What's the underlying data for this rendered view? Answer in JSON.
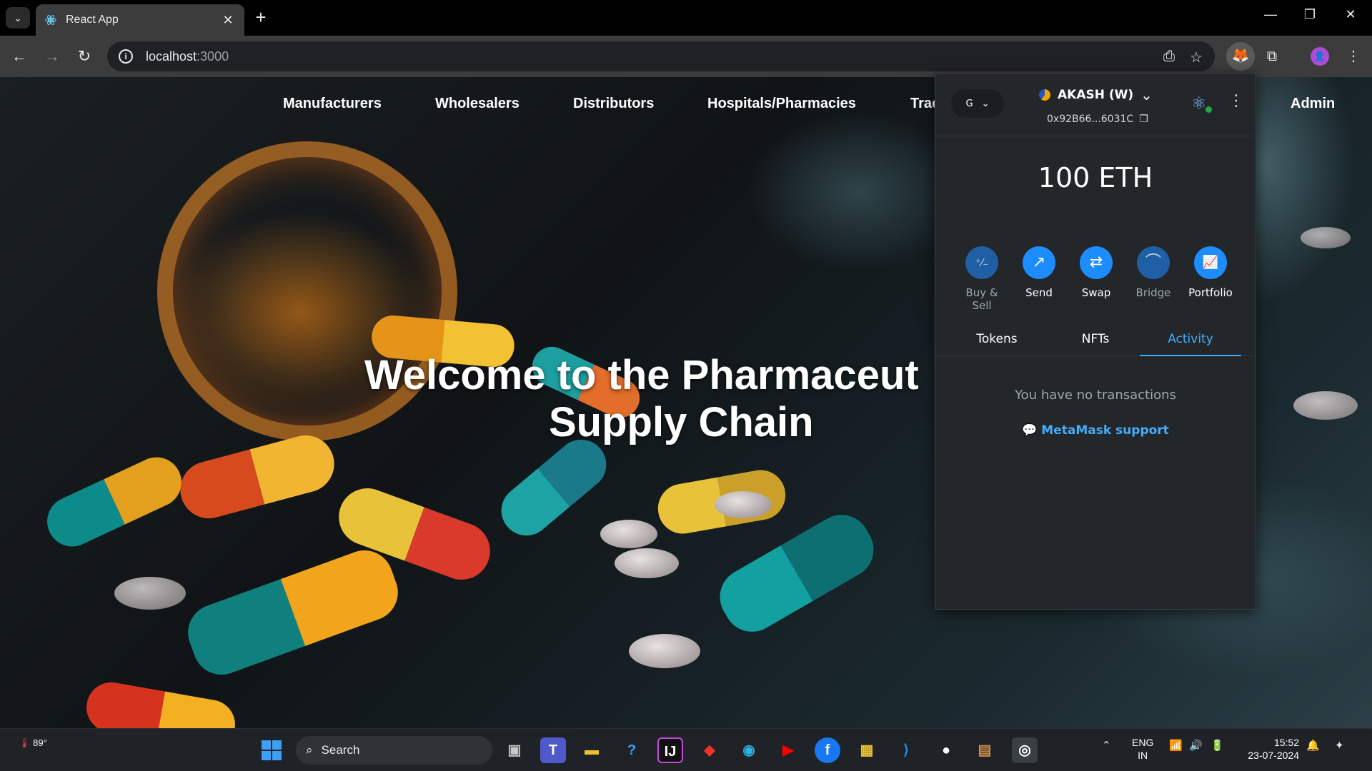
{
  "browser": {
    "tab_title": "React App",
    "tab_close": "✕",
    "new_tab": "+",
    "url_host": "localhost",
    "url_port": ":3000",
    "window_controls": [
      "—",
      "❐",
      "✕"
    ],
    "profile_initial": "👤"
  },
  "nav": {
    "items": [
      "Manufacturers",
      "Wholesalers",
      "Distributors",
      "Hospitals/Pharmacies",
      "Trac",
      "Admin"
    ]
  },
  "hero": {
    "line1": "Welcome to the Pharmaceut",
    "line2": "Supply Chain"
  },
  "metamask": {
    "network_letter": "G",
    "account_name": "AKASH (W)",
    "address": "0x92B66...6031C",
    "balance": "100 ETH",
    "actions": [
      {
        "label": "Buy & Sell",
        "icon": "buy-sell-icon",
        "glyph": "⁺⁄₋"
      },
      {
        "label": "Send",
        "icon": "send-icon",
        "glyph": "↗"
      },
      {
        "label": "Swap",
        "icon": "swap-icon",
        "glyph": "⇄"
      },
      {
        "label": "Bridge",
        "icon": "bridge-icon",
        "glyph": "⌒"
      },
      {
        "label": "Portfolio",
        "icon": "portfolio-icon",
        "glyph": "📈"
      }
    ],
    "tabs": [
      "Tokens",
      "NFTs",
      "Activity"
    ],
    "active_tab": "Activity",
    "empty_message": "You have no transactions",
    "support_link": "MetaMask support"
  },
  "taskbar": {
    "temperature": "89°",
    "search_placeholder": "Search",
    "lang_line1": "ENG",
    "lang_line2": "IN",
    "time": "15:52",
    "date": "23-07-2024"
  },
  "colors": {
    "metamask_bg": "#24272a",
    "metamask_accent": "#43aefc",
    "action_blue": "#1d8cff"
  }
}
